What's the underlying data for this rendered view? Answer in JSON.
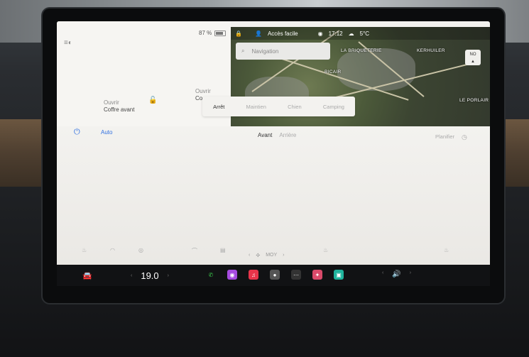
{
  "status": {
    "battery_percent": "87 %"
  },
  "doors": {
    "front_trunk": {
      "state": "Ouvrir",
      "label": "Coffre avant"
    },
    "rear_trunk": {
      "state": "Ouvrir",
      "label": "Co"
    }
  },
  "map_header": {
    "easy_access": "Accès facile",
    "time": "17:12",
    "temperature": "5°C"
  },
  "navigation": {
    "placeholder": "Navigation"
  },
  "map_places": [
    "LA BRIQUETERIE",
    "KERHUILER",
    "BICAIR",
    "LE PORLAIR"
  ],
  "compass": {
    "label": "NO"
  },
  "modes": {
    "items": [
      "Arrêt",
      "Maintien",
      "Chien",
      "Camping"
    ],
    "active": "Arrêt"
  },
  "climate": {
    "auto_label": "Auto",
    "tabs": [
      "Avant",
      "Arrière"
    ],
    "schedule_label": "Planifier",
    "fan_label": "MOY"
  },
  "taskbar": {
    "cabin_temp": "19.0"
  },
  "colors": {
    "accent": "#2f6fe0",
    "screen_bg": "#f2f1ee",
    "taskbar": "#111214"
  },
  "icons": {
    "power": "power-icon",
    "lamp": "headlight-icon",
    "lock": "unlock-icon",
    "phone": "phone-icon",
    "podcast": "podcast-icon",
    "music": "music-icon",
    "camera": "camera-icon",
    "more": "more-icon",
    "toybox": "toybox-icon",
    "theater": "theater-icon",
    "volume": "volume-icon"
  }
}
